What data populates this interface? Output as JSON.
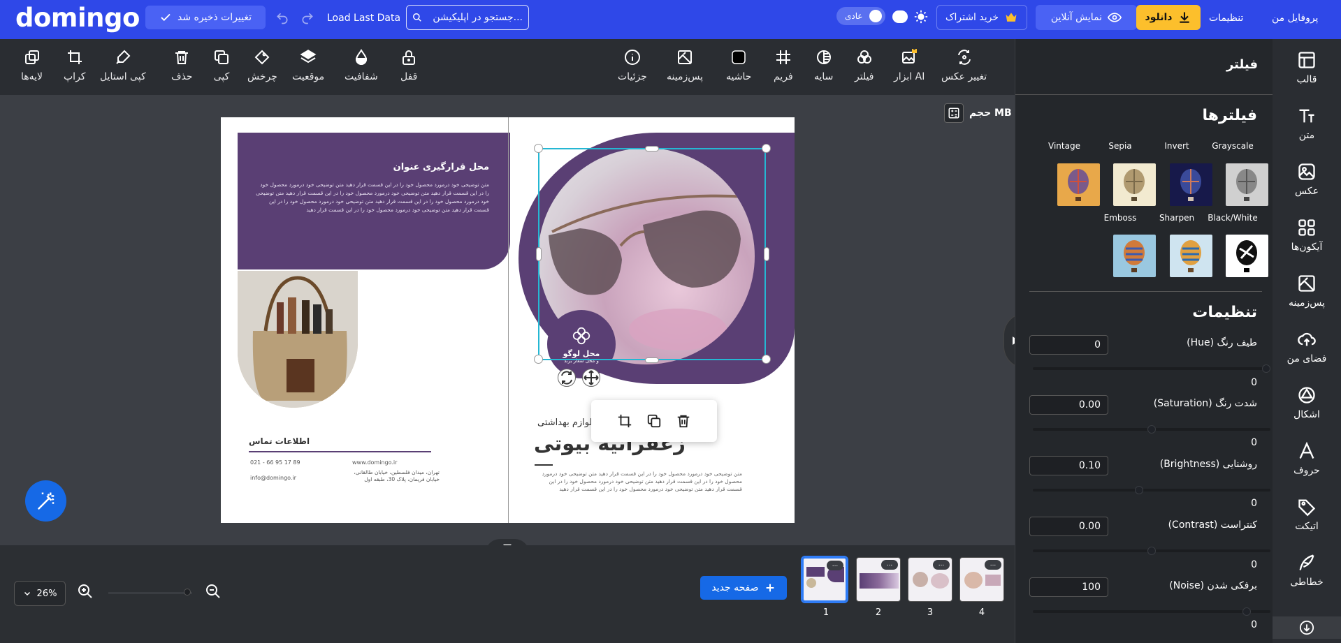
{
  "topbar": {
    "brand": "domingo",
    "save_label": "تغییرات ذخیره شد",
    "load_label": "Load Last Data",
    "search_placeholder": "جستجو در اپلیکیشن...",
    "theme_toggle_label": "عادی",
    "subscribe_label": "خرید اشتراک",
    "preview_label": "نمایش آنلاین",
    "download_label": "دانلود",
    "settings_label": "تنظیمات",
    "profile_label": "پروفایل من",
    "accent": "#2f48e8",
    "download_color": "#fcbf2c"
  },
  "toolbar": {
    "right_tools": [
      {
        "label": "تغییر عکس",
        "icon": "change-photo-icon"
      },
      {
        "label": "ابزار AI",
        "icon": "ai-tool-icon"
      },
      {
        "label": "فیلتر",
        "icon": "filter-icon"
      },
      {
        "label": "سایه",
        "icon": "shadow-icon"
      },
      {
        "label": "فریم",
        "icon": "frame-icon"
      },
      {
        "label": "حاشیه",
        "icon": "border-icon"
      },
      {
        "label": "پس‌زمینه",
        "icon": "background-icon"
      },
      {
        "label": "جزئیات",
        "icon": "details-icon"
      }
    ],
    "left_tools": [
      {
        "label": "قفل",
        "icon": "lock-icon"
      },
      {
        "label": "شفافیت",
        "icon": "opacity-icon"
      },
      {
        "label": "موقعیت",
        "icon": "position-icon"
      },
      {
        "label": "چرخش",
        "icon": "rotate-icon"
      },
      {
        "label": "کپی",
        "icon": "copy-icon"
      },
      {
        "label": "حذف",
        "icon": "delete-icon"
      },
      {
        "label": "کپی استایل",
        "icon": "copy-style-icon"
      },
      {
        "label": "کراپ",
        "icon": "crop-icon"
      },
      {
        "label": "لایه‌ها",
        "icon": "layers-icon"
      }
    ]
  },
  "canvas": {
    "size_label": "حجم MB",
    "left_page": {
      "title": "محل قرارگیری عنوان",
      "body": "متن توضیحی خود درمورد محصول خود را در این قسمت قرار دهید متن توضیحی خود درمورد محصول خود را در این قسمت قرار دهید  متن توضیحی خود درمورد محصول خود را در این قسمت قرار دهید  متن توضیحی خود درمورد محصول خود را در این قسمت قرار دهید  متن توضیحی خود درمورد محصول خود را در این قسمت قرار دهید  متن توضیحی خود درمورد محصول خود را در این قسمت قرار دهید",
      "contact_title": "اطلاعات تماس",
      "phone": "021 - 66 95 17 89",
      "email": "info@domingo.ir",
      "website": "www.domingo.ir",
      "address": "تهران، میدان فلسطین، خیابان طالقانی، خیابان فریمان، پلاک 30، طبقه اول"
    },
    "right_page": {
      "logo_title": "محل لوگو",
      "logo_sub": "و محل شعار برند",
      "subtitle": "لوازم بهداشتی",
      "title": "زعفرانیه بیوتی",
      "body": "متن توضیحی خود درمورد محصول خود را در این قسمت قرار دهید  متن توضیحی خود درمورد محصول خود را در این قسمت قرار دهید  متن توضیحی خود درمورد محصول خود را در این قسمت قرار دهید  متن توضیحی خود درمورد محصول خود را در این قسمت قرار دهید"
    },
    "purple": "#5a3f74"
  },
  "bottom": {
    "zoom": "26%",
    "new_page_label": "صفحه جدید",
    "thumb_dots": "...",
    "pages": [
      "1",
      "2",
      "3",
      "4"
    ],
    "active_page": "1"
  },
  "panel": {
    "title": "فیلتر",
    "filters_title": "فیلترها",
    "filters": [
      "Grayscale",
      "Invert",
      "Sepia",
      "Vintage",
      "Black/White",
      "Sharpen",
      "Emboss"
    ],
    "settings_title": "تنظیمات",
    "settings": [
      {
        "label": "طیف رنگ (Hue)",
        "value": "0",
        "slider_value": "0"
      },
      {
        "label": "شدت رنگ (Saturation)",
        "value": "0.00",
        "slider_value": "0"
      },
      {
        "label": "روشنایی (Brightness)",
        "value": "0.10",
        "slider_value": "0"
      },
      {
        "label": "کنتراست (Contrast)",
        "value": "0.00",
        "slider_value": "0"
      },
      {
        "label": "برفکی شدن (Noise)",
        "value": "100",
        "slider_value": "0"
      }
    ]
  },
  "rail": {
    "items": [
      {
        "label": "قالب",
        "icon": "template-icon"
      },
      {
        "label": "متن",
        "icon": "text-icon"
      },
      {
        "label": "عکس",
        "icon": "image-icon"
      },
      {
        "label": "آیکون‌ها",
        "icon": "icons-icon"
      },
      {
        "label": "پس‌زمینه",
        "icon": "background-icon"
      },
      {
        "label": "فضای من",
        "icon": "cloud-upload-icon"
      },
      {
        "label": "اشکال",
        "icon": "shapes-icon"
      },
      {
        "label": "حروف",
        "icon": "font-icon"
      },
      {
        "label": "اتیکت",
        "icon": "sticker-icon"
      },
      {
        "label": "خطاطی",
        "icon": "calligraphy-icon"
      }
    ]
  }
}
